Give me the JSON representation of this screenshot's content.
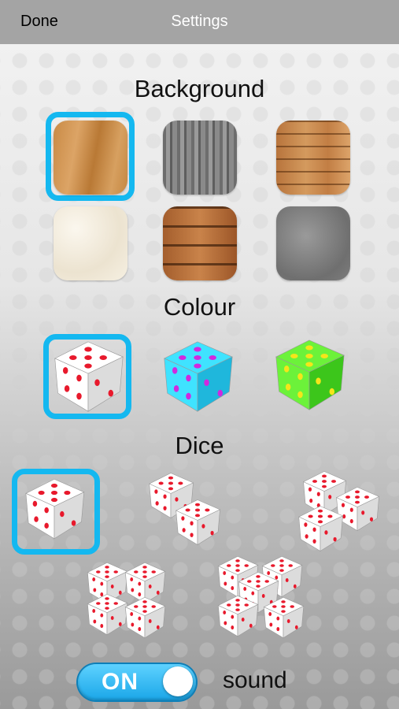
{
  "nav": {
    "done_label": "Done",
    "title": "Settings"
  },
  "sections": {
    "background": "Background",
    "colour": "Colour",
    "dice": "Dice"
  },
  "backgrounds": [
    {
      "name": "light oak wood",
      "selected": true
    },
    {
      "name": "grey weathered wood",
      "selected": false
    },
    {
      "name": "wood planks",
      "selected": false
    },
    {
      "name": "white marble",
      "selected": false
    },
    {
      "name": "dark wood boards",
      "selected": false
    },
    {
      "name": "granite",
      "selected": false
    }
  ],
  "colours": [
    {
      "name": "white",
      "face": "#ffffff",
      "side": "#dcdcdc",
      "pip": "#e8192c",
      "selected": true
    },
    {
      "name": "cyan",
      "face": "#3fe3ff",
      "side": "#1fb7dc",
      "pip": "#d02adf",
      "selected": false
    },
    {
      "name": "green",
      "face": "#6cf23a",
      "side": "#3cc61b",
      "pip": "#f5e51a",
      "selected": false
    }
  ],
  "dice_counts": [
    {
      "count": 1,
      "selected": true
    },
    {
      "count": 2,
      "selected": false
    },
    {
      "count": 3,
      "selected": false
    },
    {
      "count": 4,
      "selected": false
    },
    {
      "count": 5,
      "selected": false
    }
  ],
  "sound": {
    "toggle_label": "ON",
    "label": "sound",
    "on": true
  },
  "accent_color": "#14b8f0"
}
